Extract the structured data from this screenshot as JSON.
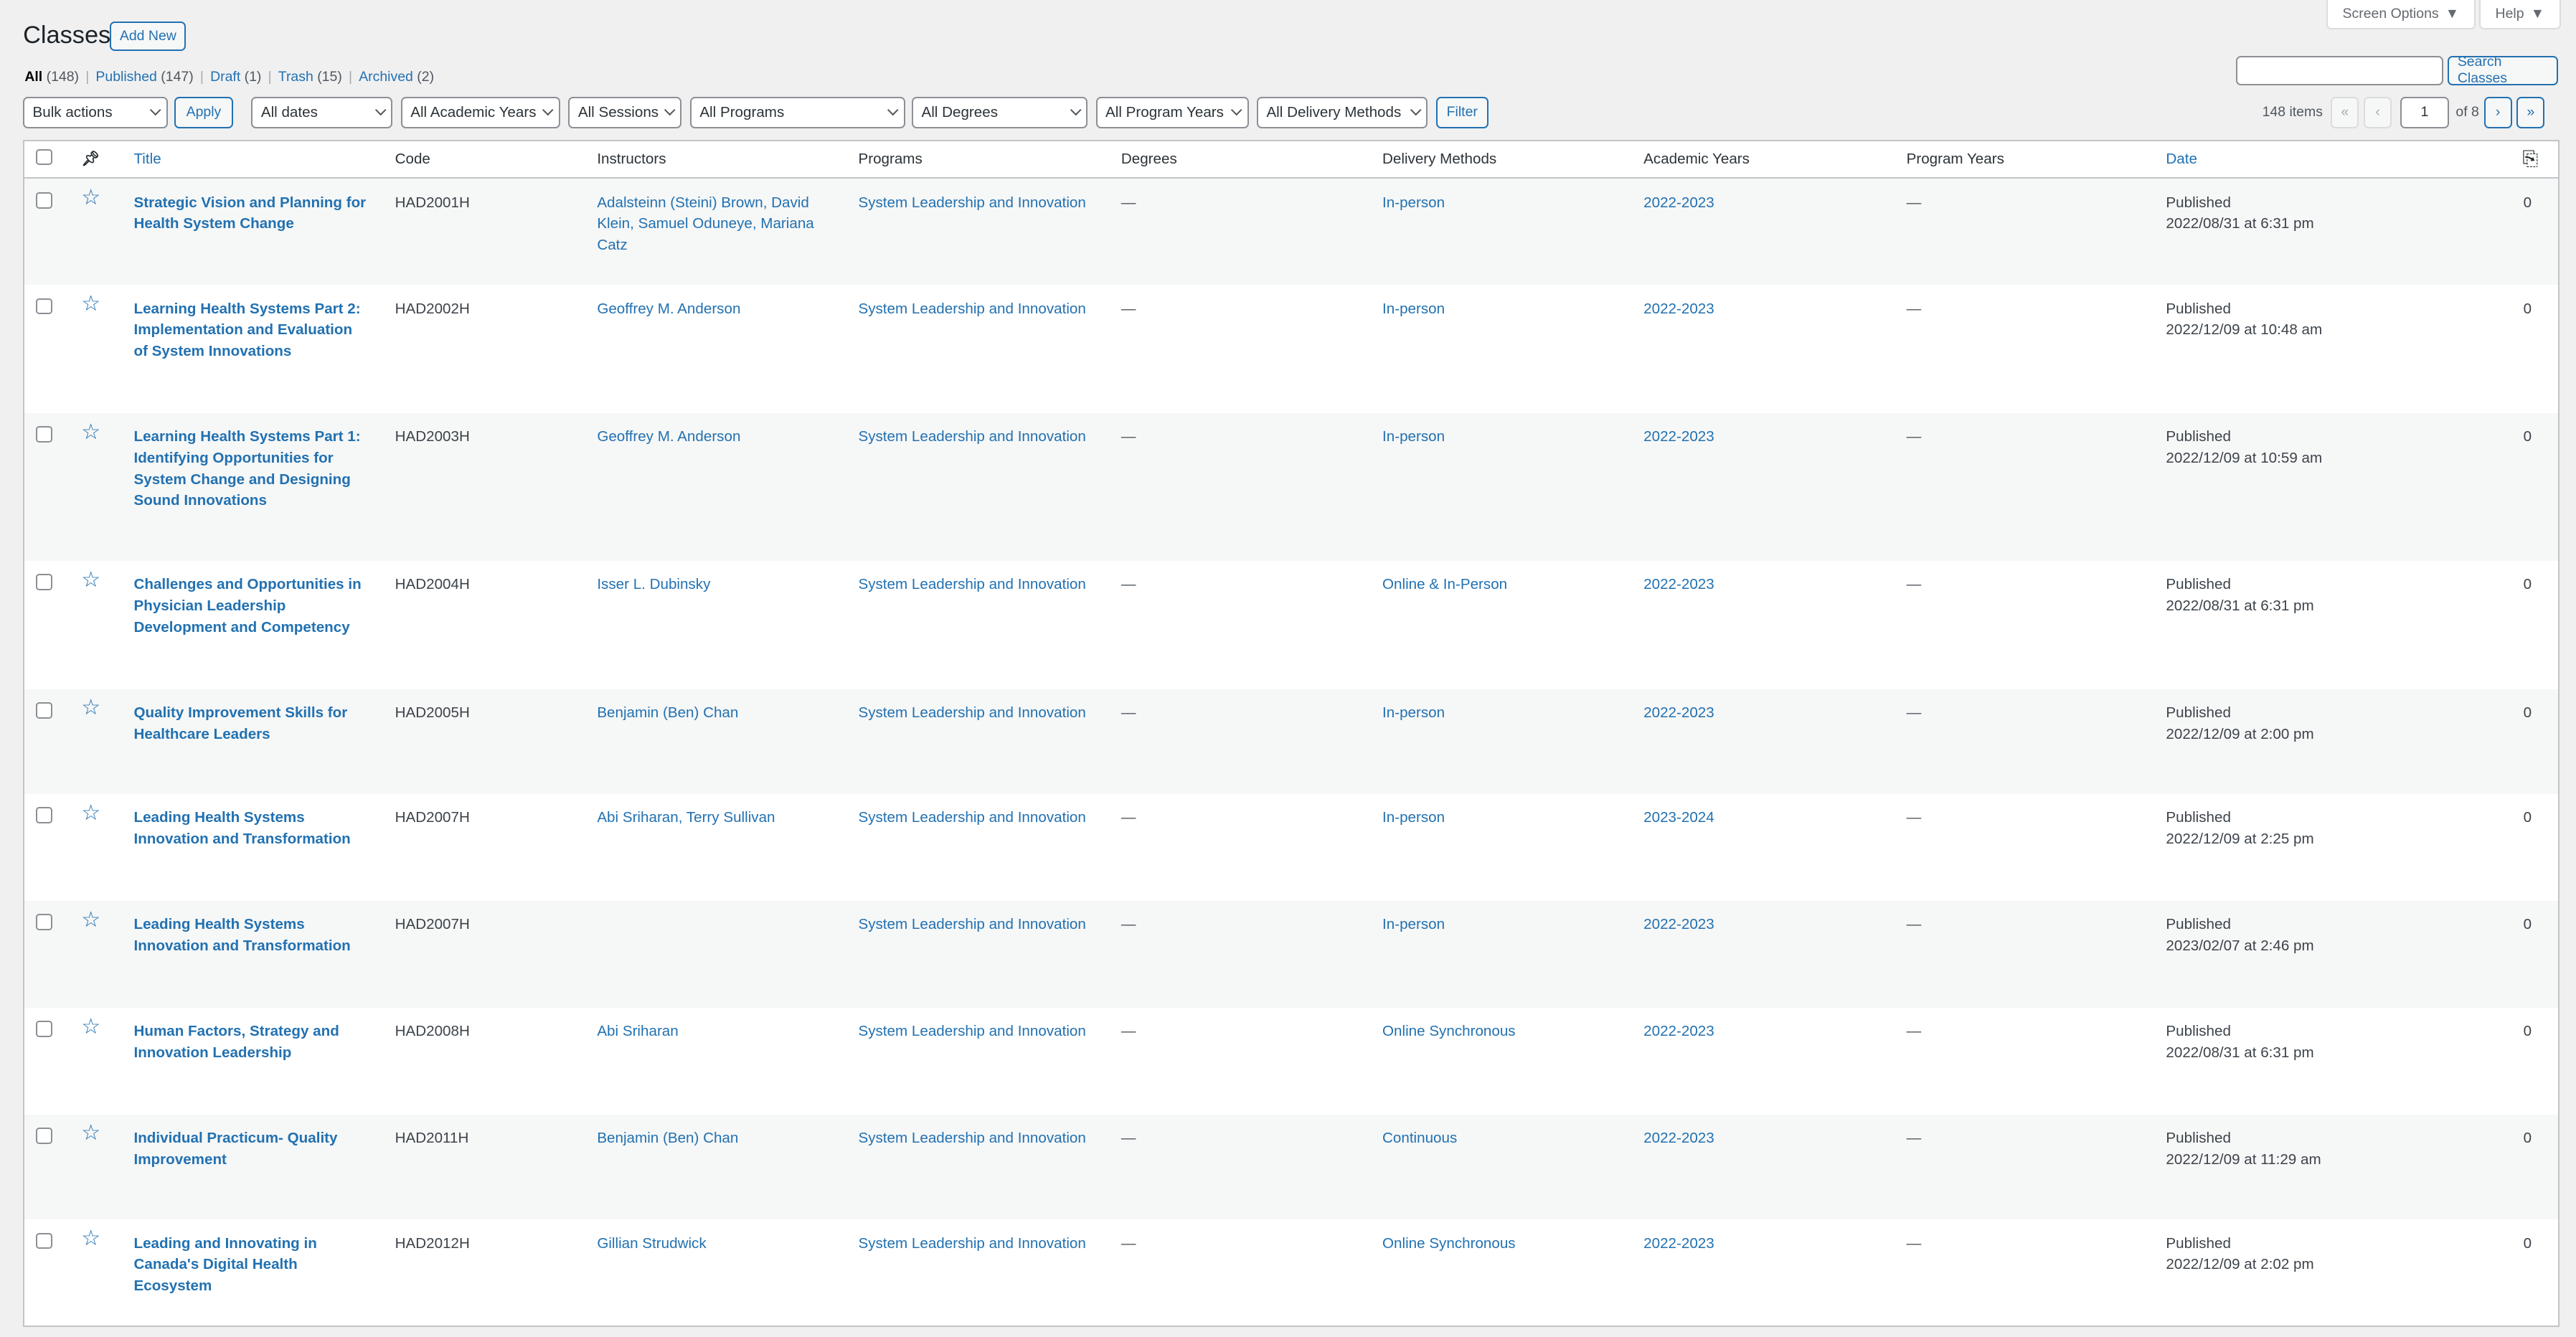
{
  "header": {
    "title": "Classes",
    "add_new": "Add New",
    "screen_options": "Screen Options",
    "help": "Help"
  },
  "views": [
    {
      "label": "All",
      "count": "(148)",
      "current": true
    },
    {
      "label": "Published",
      "count": "(147)"
    },
    {
      "label": "Draft",
      "count": "(1)"
    },
    {
      "label": "Trash",
      "count": "(15)"
    },
    {
      "label": "Archived",
      "count": "(2)"
    }
  ],
  "search": {
    "value": "",
    "button": "Search Classes"
  },
  "filters": {
    "bulk": "Bulk actions",
    "apply": "Apply",
    "dates": "All dates",
    "academic_years": "All Academic Years",
    "sessions": "All Sessions",
    "programs": "All Programs",
    "degrees": "All Degrees",
    "program_years": "All Program Years",
    "delivery": "All Delivery Methods",
    "filter": "Filter"
  },
  "pagination": {
    "items": "148 items",
    "first": "«",
    "prev": "‹",
    "current": "1",
    "of": "of 8",
    "next": "›",
    "last": "»"
  },
  "columns": {
    "title": "Title",
    "code": "Code",
    "instructors": "Instructors",
    "programs": "Programs",
    "degrees": "Degrees",
    "delivery": "Delivery Methods",
    "academic_years": "Academic Years",
    "program_years": "Program Years",
    "date": "Date"
  },
  "colors": {
    "link": "#2271b1",
    "stripe": "#f6f7f7"
  },
  "rows": [
    {
      "title": "Strategic Vision and Planning for Health System Change",
      "code": "HAD2001H",
      "instructors": "Adalsteinn (Steini) Brown, David Klein, Samuel Oduneye, Mariana Catz",
      "programs": "System Leadership and Innovation",
      "degrees": "—",
      "delivery": "In-person",
      "academic_year": "2022-2023",
      "program_years": "—",
      "status": "Published",
      "date": "2022/08/31 at 6:31 pm",
      "comments": "0"
    },
    {
      "title": "Learning Health Systems Part 2: Implementation and Evaluation of System Innovations",
      "code": "HAD2002H",
      "instructors": "Geoffrey M. Anderson",
      "programs": "System Leadership and Innovation",
      "degrees": "—",
      "delivery": "In-person",
      "academic_year": "2022-2023",
      "program_years": "—",
      "status": "Published",
      "date": "2022/12/09 at 10:48 am",
      "comments": "0"
    },
    {
      "title": "Learning Health Systems Part 1: Identifying Opportunities for System Change and Designing Sound Innovations",
      "code": "HAD2003H",
      "instructors": "Geoffrey M. Anderson",
      "programs": "System Leadership and Innovation",
      "degrees": "—",
      "delivery": "In-person",
      "academic_year": "2022-2023",
      "program_years": "—",
      "status": "Published",
      "date": "2022/12/09 at 10:59 am",
      "comments": "0"
    },
    {
      "title": "Challenges and Opportunities in Physician Leadership Development and Competency",
      "code": "HAD2004H",
      "instructors": "Isser L. Dubinsky",
      "programs": "System Leadership and Innovation",
      "degrees": "—",
      "delivery": "Online & In-Person",
      "academic_year": "2022-2023",
      "program_years": "—",
      "status": "Published",
      "date": "2022/08/31 at 6:31 pm",
      "comments": "0"
    },
    {
      "title": "Quality Improvement Skills for Healthcare Leaders",
      "code": "HAD2005H",
      "instructors": "Benjamin (Ben) Chan",
      "programs": "System Leadership and Innovation",
      "degrees": "—",
      "delivery": "In-person",
      "academic_year": "2022-2023",
      "program_years": "—",
      "status": "Published",
      "date": "2022/12/09 at 2:00 pm",
      "comments": "0"
    },
    {
      "title": "Leading Health Systems Innovation and Transformation",
      "code": "HAD2007H",
      "instructors": "Abi Sriharan, Terry Sullivan",
      "programs": "System Leadership and Innovation",
      "degrees": "—",
      "delivery": "In-person",
      "academic_year": "2023-2024",
      "program_years": "—",
      "status": "Published",
      "date": "2022/12/09 at 2:25 pm",
      "comments": "0"
    },
    {
      "title": "Leading Health Systems Innovation and Transformation",
      "code": "HAD2007H",
      "instructors": "",
      "programs": "System Leadership and Innovation",
      "degrees": "—",
      "delivery": "In-person",
      "academic_year": "2022-2023",
      "program_years": "—",
      "status": "Published",
      "date": "2023/02/07 at 2:46 pm",
      "comments": "0"
    },
    {
      "title": "Human Factors, Strategy and Innovation Leadership",
      "code": "HAD2008H",
      "instructors": "Abi Sriharan",
      "programs": "System Leadership and Innovation",
      "degrees": "—",
      "delivery": "Online Synchronous",
      "academic_year": "2022-2023",
      "program_years": "—",
      "status": "Published",
      "date": "2022/08/31 at 6:31 pm",
      "comments": "0"
    },
    {
      "title": "Individual Practicum- Quality Improvement",
      "code": "HAD2011H",
      "instructors": "Benjamin (Ben) Chan",
      "programs": "System Leadership and Innovation",
      "degrees": "—",
      "delivery": "Continuous",
      "academic_year": "2022-2023",
      "program_years": "—",
      "status": "Published",
      "date": "2022/12/09 at 11:29 am",
      "comments": "0"
    },
    {
      "title": "Leading and Innovating in Canada's Digital Health Ecosystem",
      "code": "HAD2012H",
      "instructors": "Gillian Strudwick",
      "programs": "System Leadership and Innovation",
      "degrees": "—",
      "delivery": "Online Synchronous",
      "academic_year": "2022-2023",
      "program_years": "—",
      "status": "Published",
      "date": "2022/12/09 at 2:02 pm",
      "comments": "0"
    }
  ]
}
